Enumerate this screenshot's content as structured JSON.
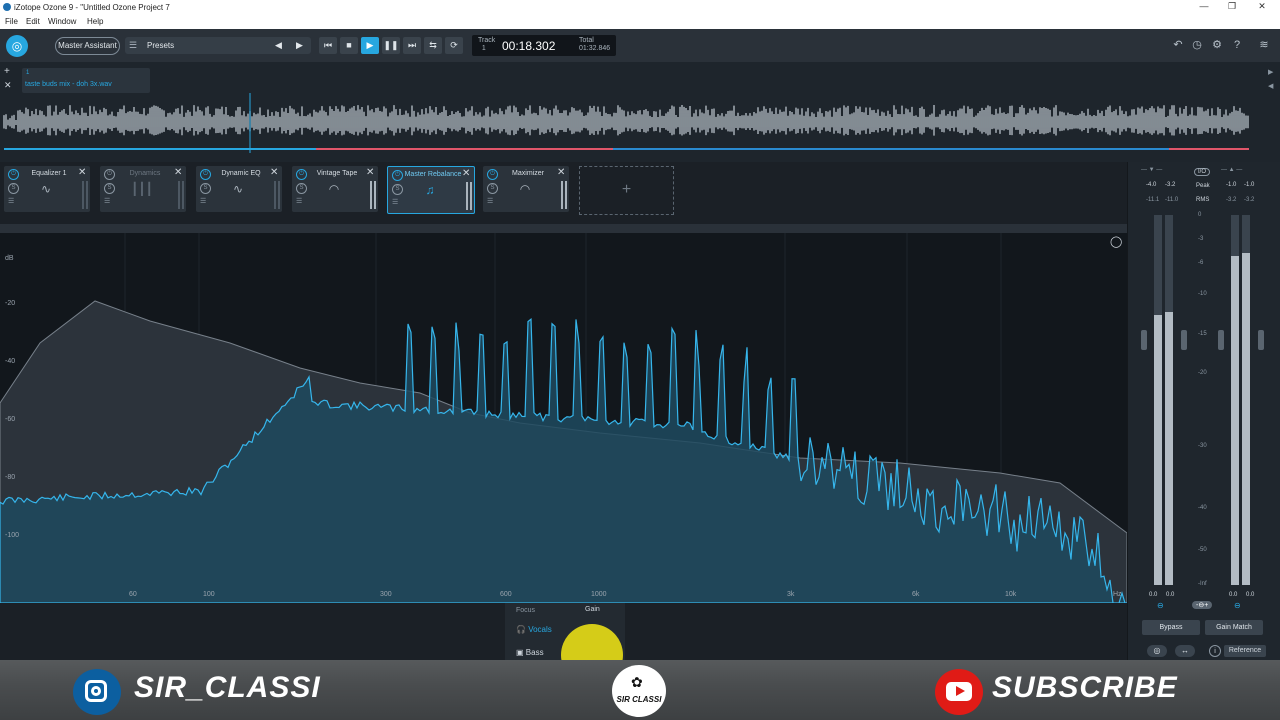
{
  "window": {
    "title": "iZotope Ozone 9 - \"Untitled Ozone Project 7",
    "min_icon": "minimize-icon",
    "max_icon": "maximize-icon",
    "close_icon": "close-icon",
    "min_glyph": "—",
    "max_glyph": "❐",
    "close_glyph": "✕"
  },
  "menu": [
    "File",
    "Edit",
    "Window",
    "Help"
  ],
  "toolbar": {
    "master_assistant": "Master Assistant",
    "presets": "Presets",
    "track_label": "Track",
    "track_num": "1",
    "time": "00:18.302",
    "total_label": "Total",
    "total_time": "01:32.846"
  },
  "track": {
    "number": "1",
    "filename": "taste buds mix - doh 3x.wav"
  },
  "modules": [
    {
      "name": "Equalizer 1",
      "enabled": true
    },
    {
      "name": "Dynamics",
      "enabled": false
    },
    {
      "name": "Dynamic EQ",
      "enabled": true
    },
    {
      "name": "Vintage Tape",
      "enabled": true
    },
    {
      "name": "Master Rebalance",
      "enabled": true,
      "selected": true
    },
    {
      "name": "Maximizer",
      "enabled": true
    }
  ],
  "spectrum": {
    "db_label": "dB",
    "y_labels": [
      "-20",
      "-40",
      "-60",
      "-80",
      "-100"
    ],
    "x_labels": [
      "60",
      "100",
      "300",
      "600",
      "1000",
      "3k",
      "6k",
      "10k",
      "Hz"
    ]
  },
  "focus": {
    "focus_label": "Focus",
    "gain_label": "Gain",
    "vocals": "Vocals",
    "bass": "Bass"
  },
  "meters": {
    "io": "I/O",
    "peak": "Peak",
    "rms": "RMS",
    "in_peak": [
      "-4.0",
      "-3.2"
    ],
    "in_rms": [
      "-11.1",
      "-11.0"
    ],
    "out_peak": [
      "-1.0",
      "-1.0"
    ],
    "out_rms": [
      "-3.2",
      "-3.2"
    ],
    "scale": [
      "0",
      "-3",
      "-6",
      "-10",
      "-15",
      "-20",
      "-30",
      "-40",
      "-50",
      "-Inf"
    ],
    "in_bottom": [
      "0.0",
      "0.0"
    ],
    "out_bottom": [
      "0.0",
      "0.0"
    ],
    "bypass": "Bypass",
    "gain_match": "Gain Match",
    "reference": "Reference"
  },
  "banner": {
    "instagram_handle": "SIR_CLASSI",
    "logo_text": "SIR CLASSI",
    "subscribe": "SUBSCRIBE"
  },
  "colors": {
    "accent": "#27a7e0",
    "spectrum_fill": "#1f4a5f",
    "instagram": "#0c5fa0",
    "youtube": "#e01b16"
  }
}
